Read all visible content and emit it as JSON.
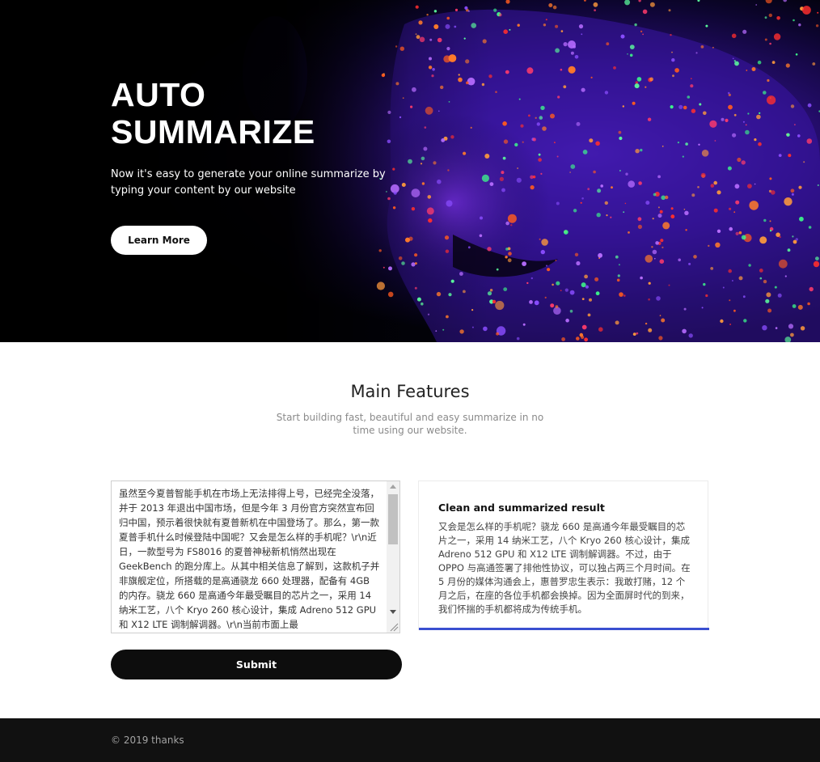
{
  "hero": {
    "title_line1": "AUTO",
    "title_line2": "SUMMARIZE",
    "subtitle": "Now it's easy to generate your online summarize by typing your content by our website",
    "button_label": "Learn More",
    "image": "colorful-neon-paint-face-photo"
  },
  "features": {
    "title": "Main Features",
    "subtitle": "Start building fast, beautiful and easy summarize in no time using our website."
  },
  "input": {
    "value": "虽然至今夏普智能手机在市场上无法排得上号，已经完全没落，并于 2013 年退出中国市场，但是今年 3 月份官方突然宣布回归中国，预示着很快就有夏普新机在中国登场了。那么，第一款夏普手机什么时候登陆中国呢？又会是怎么样的手机呢？\\r\\n近日，一款型号为 FS8016 的夏普神秘新机悄然出现在 GeekBench 的跑分库上。从其中相关信息了解到，这款机子并非旗舰定位，所搭载的是高通骁龙 660 处理器，配备有 4GB 的内存。骁龙 660 是高通今年最受瞩目的芯片之一，采用 14 纳米工艺，八个 Kryo 260 核心设计，集成 Adreno 512 GPU 和 X12 LTE 调制解调器。\\r\\n当前市面上最"
  },
  "submit_label": "Submit",
  "result": {
    "title": "Clean and summarized result",
    "text": "又会是怎么样的手机呢？骁龙 660 是高通今年最受瞩目的芯片之一，采用 14 纳米工艺，八个 Kryo 260 核心设计，集成 Adreno 512 GPU 和 X12 LTE 调制解调器。不过，由于 OPPO 与高通签署了排他性协议，可以独占两三个月时间。在 5 月份的媒体沟通会上，惠普罗忠生表示：我敢打赌，12 个月之后，在座的各位手机都会换掉。因为全面屏时代的到来，我们怀揣的手机都将成为传统手机。",
    "accent_color": "#3a4fd0"
  },
  "footer": {
    "text": "© 2019 thanks"
  }
}
